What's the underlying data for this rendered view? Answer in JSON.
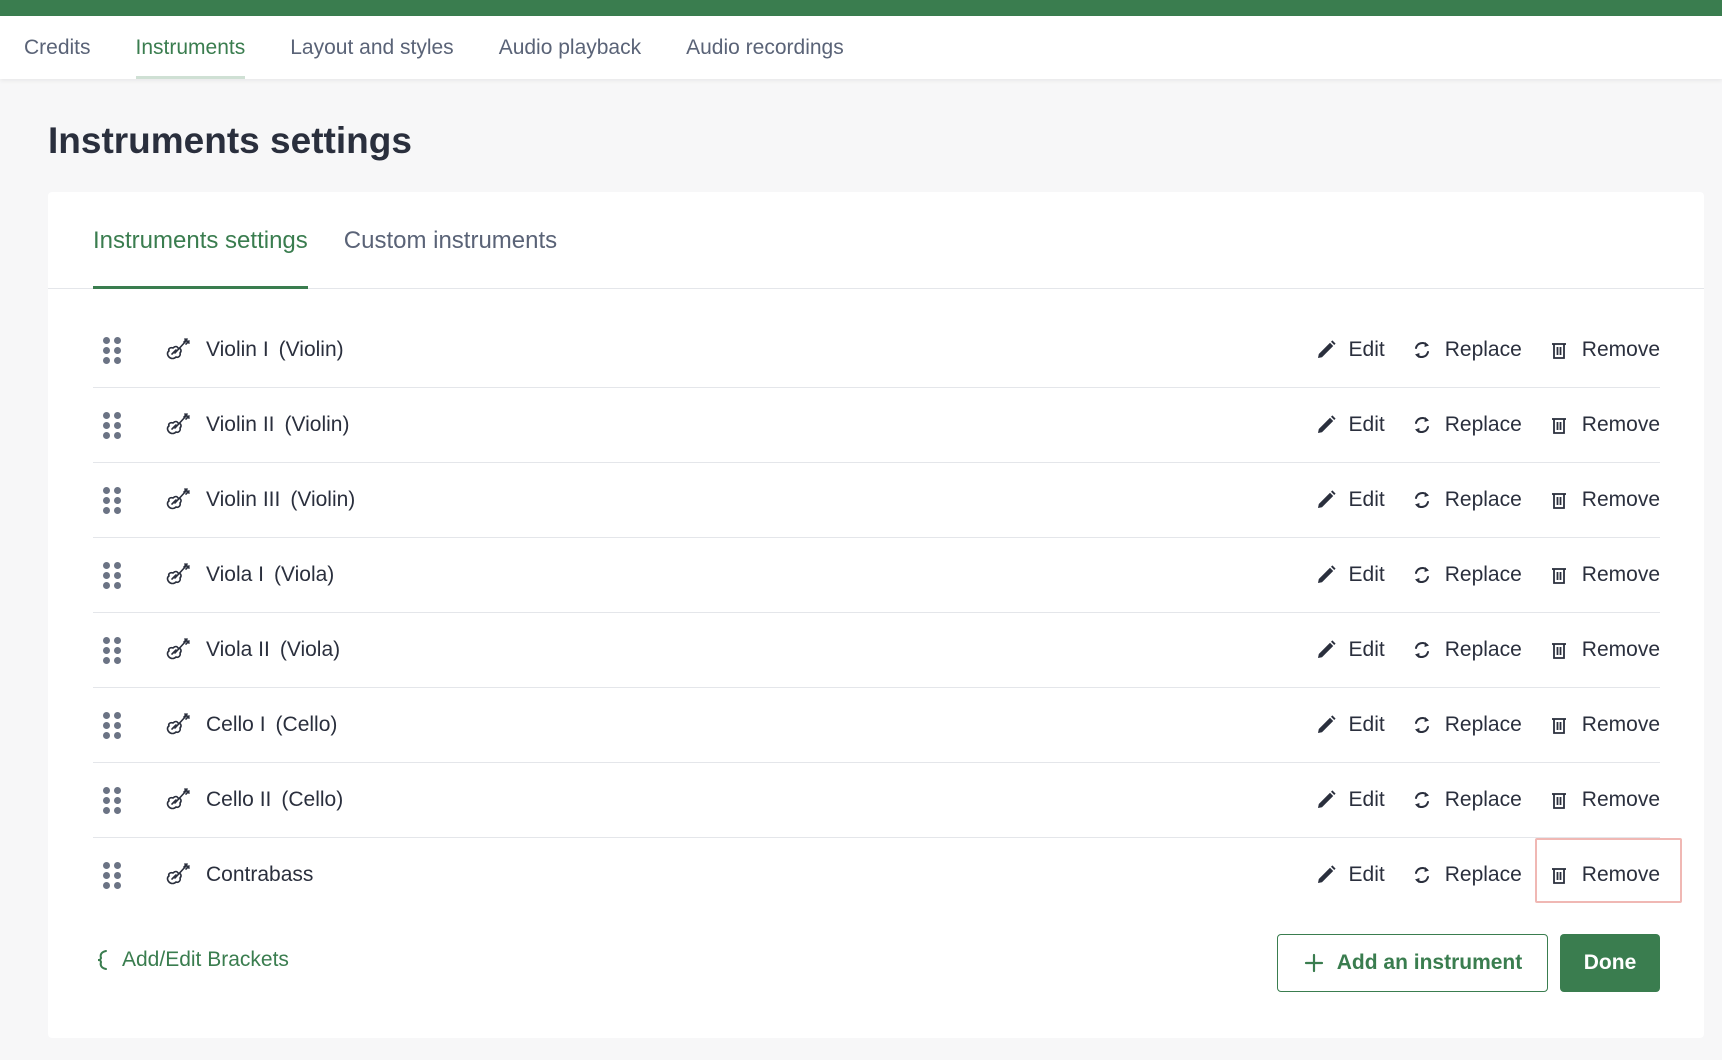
{
  "colors": {
    "brand": "#3a7d4f",
    "text": "#2a2f3d",
    "muted": "#5a6377",
    "highlight": "#f0b8b4"
  },
  "nav": {
    "items": [
      {
        "label": "Credits"
      },
      {
        "label": "Instruments"
      },
      {
        "label": "Layout and styles"
      },
      {
        "label": "Audio playback"
      },
      {
        "label": "Audio recordings"
      }
    ],
    "active": "Instruments"
  },
  "page": {
    "title": "Instruments settings"
  },
  "subtabs": {
    "items": [
      {
        "label": "Instruments settings"
      },
      {
        "label": "Custom instruments"
      }
    ],
    "active": "Instruments settings"
  },
  "actions": {
    "edit": "Edit",
    "replace": "Replace",
    "remove": "Remove"
  },
  "icons": {
    "drag": "drag-handle-icon",
    "instrument": "violin-icon",
    "edit": "pencil-icon",
    "replace": "refresh-icon",
    "remove": "trash-icon",
    "brackets": "bracket-icon",
    "add": "plus-icon"
  },
  "instruments": [
    {
      "name": "Violin I",
      "type": "(Violin)"
    },
    {
      "name": "Violin II",
      "type": "(Violin)"
    },
    {
      "name": "Violin III",
      "type": "(Violin)"
    },
    {
      "name": "Viola I",
      "type": "(Viola)"
    },
    {
      "name": "Viola II",
      "type": "(Viola)"
    },
    {
      "name": "Cello I",
      "type": "(Cello)"
    },
    {
      "name": "Cello II",
      "type": "(Cello)"
    },
    {
      "name": "Contrabass",
      "type": ""
    }
  ],
  "footer": {
    "brackets_label": "Add/Edit Brackets",
    "add_label": "Add an instrument",
    "done_label": "Done"
  }
}
